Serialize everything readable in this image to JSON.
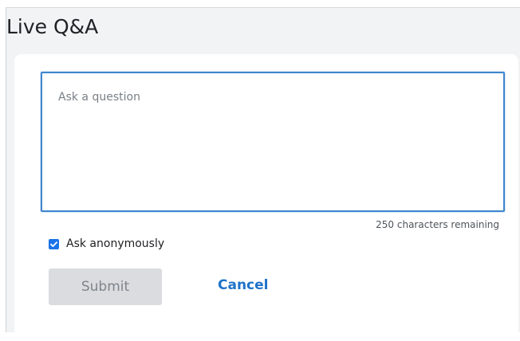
{
  "header": {
    "title": "Live Q&A"
  },
  "form": {
    "question": {
      "value": "",
      "placeholder": "Ask a question"
    },
    "counter_text": "250 characters remaining",
    "anonymous": {
      "label": "Ask anonymously",
      "checked": true
    },
    "submit_label": "Submit",
    "cancel_label": "Cancel"
  },
  "colors": {
    "accent": "#1a73e8",
    "focus_border": "#3f86cf",
    "link": "#1f73c9",
    "disabled_button_bg": "#dadce0",
    "disabled_button_text": "#7e848a",
    "page_bg": "#f1f3f4"
  },
  "icons": {
    "checkbox": "checkmark-icon"
  }
}
